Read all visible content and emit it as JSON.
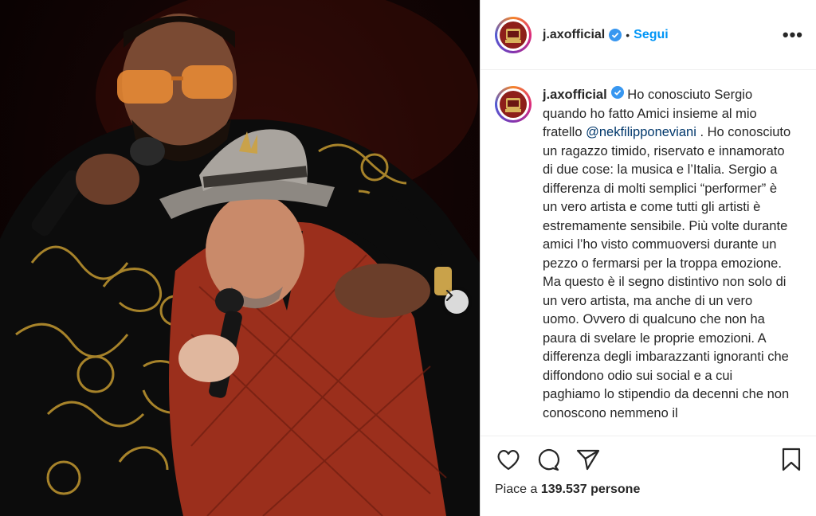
{
  "photo": {
    "alt": "j.axofficial post photo",
    "next_icon": "chevron-right-icon"
  },
  "header": {
    "username": "j.axofficial",
    "separator": "•",
    "follow_label": "Segui",
    "more_label": "•••",
    "verified_icon": "verified-badge-icon"
  },
  "caption": {
    "username": "j.axofficial",
    "text_before": " Ho conosciuto Sergio quando ho fatto Amici insieme al mio fratello ",
    "mention": "@nekfilipponeviani",
    "text_after": " . Ho conosciuto un ragazzo timido, riservato e innamorato di due cose: la musica e l’Italia. Sergio a differenza di molti semplici “performer” è un vero artista e come tutti gli artisti è estremamente sensibile. Più volte durante amici l’ho visto commuoversi durante un pezzo o fermarsi per la troppa emozione. Ma questo è il segno distintivo non solo di un vero artista, ma anche di un vero uomo. Ovvero di qualcuno che non ha paura di svelare le proprie emozioni. A differenza degli imbarazzanti ignoranti che diffondono odio sui social e a cui paghiamo lo stipendio da decenni che non conoscono nemmeno il"
  },
  "actions": {
    "like_icon": "heart-icon",
    "comment_icon": "comment-icon",
    "share_icon": "share-icon",
    "save_icon": "bookmark-icon"
  },
  "likes": {
    "prefix": "Piace a ",
    "count": "139.537",
    "suffix": " persone"
  },
  "colors": {
    "follow_blue": "#0095f6",
    "mention_blue": "#00376b",
    "verified_blue": "#3897f0"
  }
}
